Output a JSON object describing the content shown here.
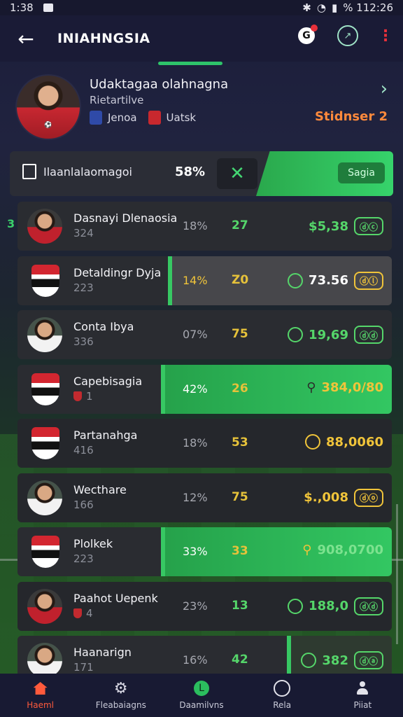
{
  "status_bar": {
    "time": "1:38",
    "right_text": "% 112:26"
  },
  "header": {
    "title": "INIAHNGSIA",
    "back_icon": "arrow-left-icon",
    "icons": [
      "g-notification-icon",
      "chart-icon",
      "more-vertical-icon"
    ]
  },
  "profile": {
    "name": "Udaktagaa olahnagna",
    "subtitle": "Rietartilve",
    "tag1": "Jenoa",
    "tag2": "Uatsk",
    "season": "Stidnser 2"
  },
  "summary": {
    "label": "Ilaanlalaomagoi",
    "percent": "58%",
    "pill": "Sagia",
    "side_number": "3"
  },
  "rows": [
    {
      "name": "Dasnayi Dlenaosia",
      "sub": "324",
      "percent": "18%",
      "number": "27",
      "value": "$5,38"
    },
    {
      "name": "Detaldingr Dyja",
      "sub": "223",
      "percent": "14%",
      "number": "Z0",
      "value": "73.56"
    },
    {
      "name": "Conta Ibya",
      "sub": "336",
      "percent": "07%",
      "number": "75",
      "value": "19,69"
    },
    {
      "name": "Capebisagia",
      "sub": "1",
      "percent": "42%",
      "number": "26",
      "value": "384,0/80"
    },
    {
      "name": "Partanahga",
      "sub": "416",
      "percent": "18%",
      "number": "53",
      "value": "88,0060"
    },
    {
      "name": "Wecthare",
      "sub": "166",
      "percent": "12%",
      "number": "75",
      "value": "$.,008"
    },
    {
      "name": "Plolkek",
      "sub": "223",
      "percent": "33%",
      "number": "33",
      "value": "908,0700"
    },
    {
      "name": "Paahot Uepenk",
      "sub": "4",
      "percent": "23%",
      "number": "13",
      "value": "188,0"
    },
    {
      "name": "Haanarign",
      "sub": "171",
      "percent": "16%",
      "number": "42",
      "value": "382"
    }
  ],
  "nav": {
    "items": [
      {
        "label": "Haeml",
        "icon": "home-icon"
      },
      {
        "label": "Fleabaiagns",
        "icon": "gear-icon"
      },
      {
        "label": "Daamilvns",
        "icon": "green-l-icon"
      },
      {
        "label": "Rela",
        "icon": "ball-icon"
      },
      {
        "label": "Piiat",
        "icon": "user-icon"
      }
    ]
  },
  "colors": {
    "accent_green": "#33c762",
    "accent_orange": "#ff8a3c",
    "value_gold": "#f0c43a"
  }
}
